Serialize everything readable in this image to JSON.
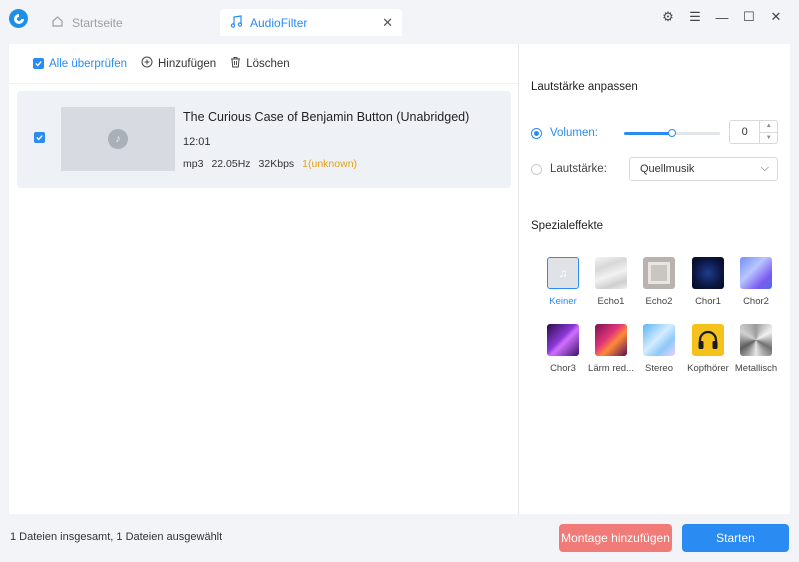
{
  "tabs": {
    "home_label": "Startseite",
    "active_label": "AudioFilter"
  },
  "toolbar": {
    "check_all_label": "Alle überprüfen",
    "add_label": "Hinzufügen",
    "delete_label": "Löschen"
  },
  "file": {
    "title": "The Curious Case of Benjamin Button (Unabridged)",
    "duration": "12:01",
    "format": "mp3",
    "samplerate": "22.05Hz",
    "bitrate": "32Kbps",
    "channels": "1(unknown)",
    "checked": true
  },
  "volume_section": {
    "title": "Lautstärke anpassen",
    "volume_label": "Volumen:",
    "volume_level": 0.5,
    "volume_value": "0",
    "loudness_label": "Lautstärke:",
    "loudness_selected": "Quellmusik"
  },
  "effects_section": {
    "title": "Spezialeffekte",
    "items": [
      {
        "label": "Keiner",
        "icon": "music-note-icon",
        "selected": true
      },
      {
        "label": "Echo1",
        "icon": "echo1-thumb"
      },
      {
        "label": "Echo2",
        "icon": "echo2-thumb"
      },
      {
        "label": "Chor1",
        "icon": "chor1-thumb"
      },
      {
        "label": "Chor2",
        "icon": "chor2-thumb"
      },
      {
        "label": "Chor3",
        "icon": "chor3-thumb"
      },
      {
        "label": "Lärm red...",
        "icon": "noise-reduction-thumb"
      },
      {
        "label": "Stereo",
        "icon": "stereo-thumb"
      },
      {
        "label": "Kopfhörer",
        "icon": "headphone-thumb"
      },
      {
        "label": "Metallisch",
        "icon": "metallic-thumb"
      }
    ]
  },
  "footer": {
    "status": "1 Dateien insgesamt, 1 Dateien ausgewählt",
    "montage_label": "Montage hinzufügen",
    "start_label": "Starten"
  },
  "colors": {
    "accent": "#2a8bf2",
    "montage": "#f07b78",
    "channel_highlight": "#e3a11a"
  }
}
